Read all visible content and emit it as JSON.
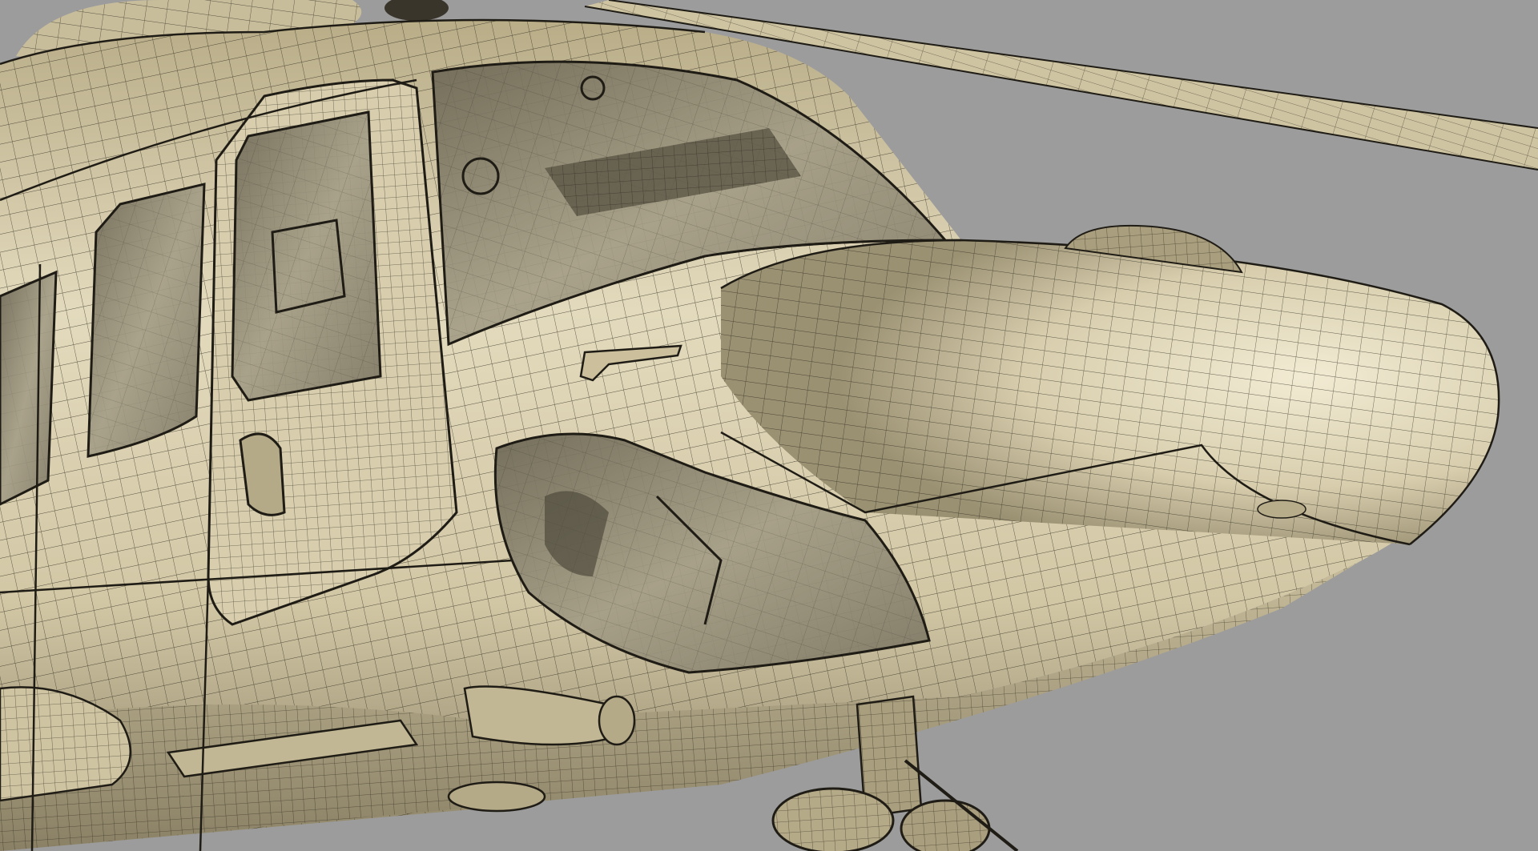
{
  "scene": {
    "subject": "helicopter-wireframe-render",
    "colors": {
      "background": "#9c9c9c",
      "hull_light": "#e8dfc2",
      "hull_mid": "#c9bd98",
      "hull_dark": "#6f6650",
      "glass": "#8a8470",
      "wire": "#1f1c15",
      "shadow": "#2a261c"
    }
  }
}
